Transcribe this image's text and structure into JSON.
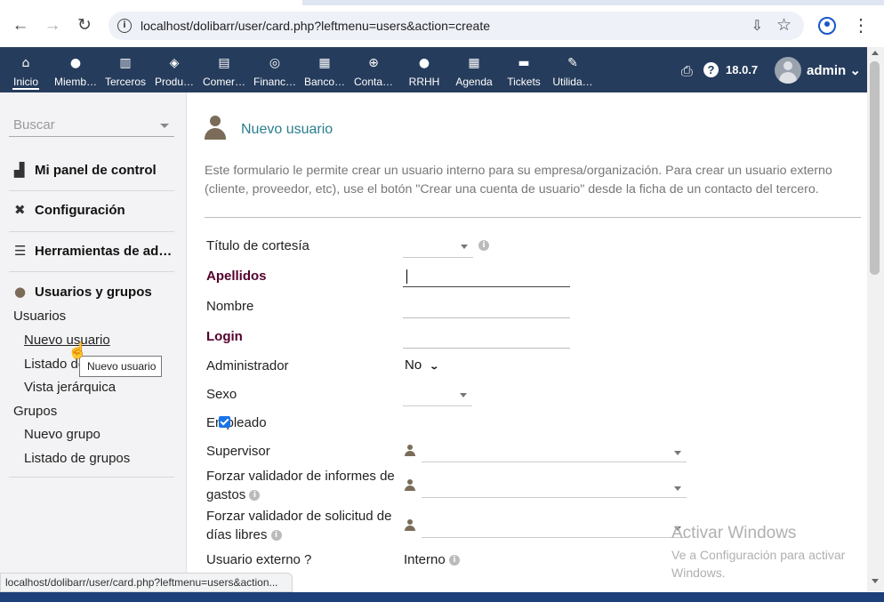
{
  "browser": {
    "url": "localhost/dolibarr/user/card.php?leftmenu=users&action=create",
    "status_url": "localhost/dolibarr/user/card.php?leftmenu=users&action...",
    "icons": [
      "back-icon",
      "forward-icon",
      "reload-icon",
      "site-info-icon",
      "install-app-icon",
      "bookmark-star-icon",
      "profile-icon",
      "kebab-menu-icon"
    ]
  },
  "topmenu": {
    "items": [
      {
        "label": "Inicio",
        "icon": "home-icon",
        "glyph": "⌂"
      },
      {
        "label": "Miemb…",
        "icon": "member-icon",
        "glyph": "●"
      },
      {
        "label": "Terceros",
        "icon": "building-icon",
        "glyph": "▥"
      },
      {
        "label": "Produ…",
        "icon": "cube-icon",
        "glyph": "◈"
      },
      {
        "label": "Comer…",
        "icon": "briefcase-icon",
        "glyph": "▤"
      },
      {
        "label": "Financ…",
        "icon": "coins-icon",
        "glyph": "◎"
      },
      {
        "label": "Banco…",
        "icon": "bank-icon",
        "glyph": "▦"
      },
      {
        "label": "Conta…",
        "icon": "search-dollar-icon",
        "glyph": "⊕"
      },
      {
        "label": "RRHH",
        "icon": "user-tie-icon",
        "glyph": "●"
      },
      {
        "label": "Agenda",
        "icon": "calendar-icon",
        "glyph": "▦"
      },
      {
        "label": "Tickets",
        "icon": "ticket-icon",
        "glyph": "▬"
      },
      {
        "label": "Utilida…",
        "icon": "wrench-icon",
        "glyph": "✎"
      }
    ],
    "version": "18.0.7",
    "username": "admin",
    "print_glyph": "⎙",
    "help_glyph": "?",
    "user_chevron": "⌄"
  },
  "sidebar": {
    "search_placeholder": "Buscar",
    "blocks": [
      {
        "title": "Mi panel de control",
        "icon": "chart-icon",
        "glyph": "▟"
      },
      {
        "title": "Configuración",
        "icon": "tools-icon",
        "glyph": "✖"
      },
      {
        "title": "Herramientas de ad…",
        "icon": "server-icon",
        "glyph": "☰"
      },
      {
        "title": "Usuarios y grupos",
        "icon": "user-icon",
        "glyph": "●"
      }
    ],
    "users_header": "Usuarios",
    "users_items": [
      "Nuevo usuario",
      "Listado de usuarios",
      "Vista jerárquica"
    ],
    "groups_header": "Grupos",
    "groups_items": [
      "Nuevo grupo",
      "Listado de grupos"
    ],
    "tooltip": "Nuevo usuario"
  },
  "page": {
    "title": "Nuevo usuario",
    "description": "Este formulario le permite crear un usuario interno para su empresa/organización. Para crear un usuario externo (cliente, proveedor, etc), use el botón \"Crear una cuenta de usuario\" desde la ficha de un contacto del tercero."
  },
  "form": {
    "titulo_label": "Título de cortesía",
    "apellidos_label": "Apellidos",
    "nombre_label": "Nombre",
    "login_label": "Login",
    "admin_label": "Administrador",
    "admin_value": "No",
    "sexo_label": "Sexo",
    "empleado_label": "Empleado",
    "empleado_checked": true,
    "supervisor_label": "Supervisor",
    "forzar_gastos_label": "Forzar validador de informes de gastos",
    "forzar_dias_label": "Forzar validador de solicitud de días libres",
    "externo_label": "Usuario externo ?",
    "externo_value": "Interno",
    "info_glyph": "i"
  },
  "watermark": {
    "line1": "Activar Windows",
    "line2": "Ve a Configuración para activar Windows."
  }
}
